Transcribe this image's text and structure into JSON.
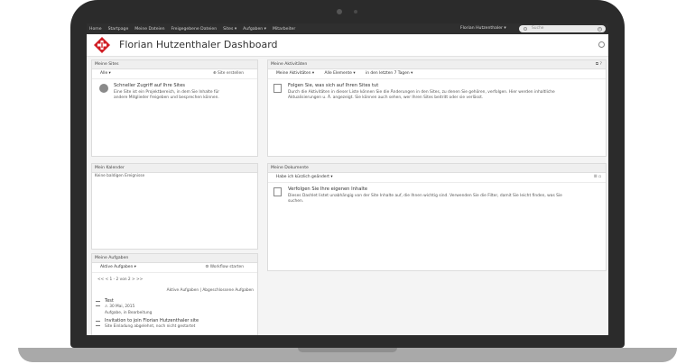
{
  "topbar": {
    "nav": [
      "Home",
      "Startpage",
      "Meine Dateien",
      "Freigegebene Dateien",
      "Sites ▾",
      "Aufgaben ▾",
      "Mitarbeiter"
    ],
    "user": "Florian Hutzenthaler ▾",
    "search_placeholder": "Suche"
  },
  "header": {
    "title": "Florian Hutzenthaler Dashboard"
  },
  "my_sites": {
    "title": "Meine Sites",
    "filter": "Alle ▾",
    "create": "Site erstellen",
    "heading": "Schneller Zugriff auf Ihre Sites",
    "desc1": "Eine Site ist ein Projektbereich, in dem Sie Inhalte für",
    "desc2": "andere Mitglieder freigeben und besprechen können."
  },
  "activities": {
    "title": "Meine Aktivitäten",
    "filter1": "Meine Aktivitäten ▾",
    "filter2": "Alle Elemente ▾",
    "filter3": "in den letzten 7 Tagen ▾",
    "heading": "Folgen Sie, was sich auf Ihren Sites tut",
    "desc1": "Durch die Aktivitäten in dieser Liste können Sie die Änderungen in den Sites, zu denen Sie gehören, verfolgen. Hier werden inhaltliche",
    "desc2": "Aktualisierungen u. Ä. angezeigt. Sie können auch sehen, wer Ihren Sites beitritt oder sie verlässt."
  },
  "calendar": {
    "title": "Mein Kalender",
    "empty": "Keine baldigen Ereignisse"
  },
  "documents": {
    "title": "Meine Dokumente",
    "filter": "Habe ich kürzlich geändert ▾",
    "heading": "Verfolgen Sie Ihre eigenen Inhalte",
    "desc1": "Dieses Dashlet listet unabhängig von der Site Inhalte auf, die Ihnen wichtig sind. Verwenden Sie die Filter, damit Sie leicht finden, was Sie",
    "desc2": "suchen."
  },
  "tasks": {
    "title": "Meine Aufgaben",
    "filter": "Aktive Aufgaben ▾",
    "start": "Workflow starten",
    "pager": "<< < 1 - 2 von 2 > >>",
    "links": "Aktive Aufgaben | Abgeschlossene Aufgaben",
    "items": [
      {
        "name": "Test",
        "date": "30 Mai, 2015",
        "status": "Aufgabe, in Bearbeitung"
      },
      {
        "name": "Invitation to join Florian Hutzenthaler site",
        "status": "Site Einladung abgelehnt, noch nicht gestartet"
      }
    ]
  }
}
